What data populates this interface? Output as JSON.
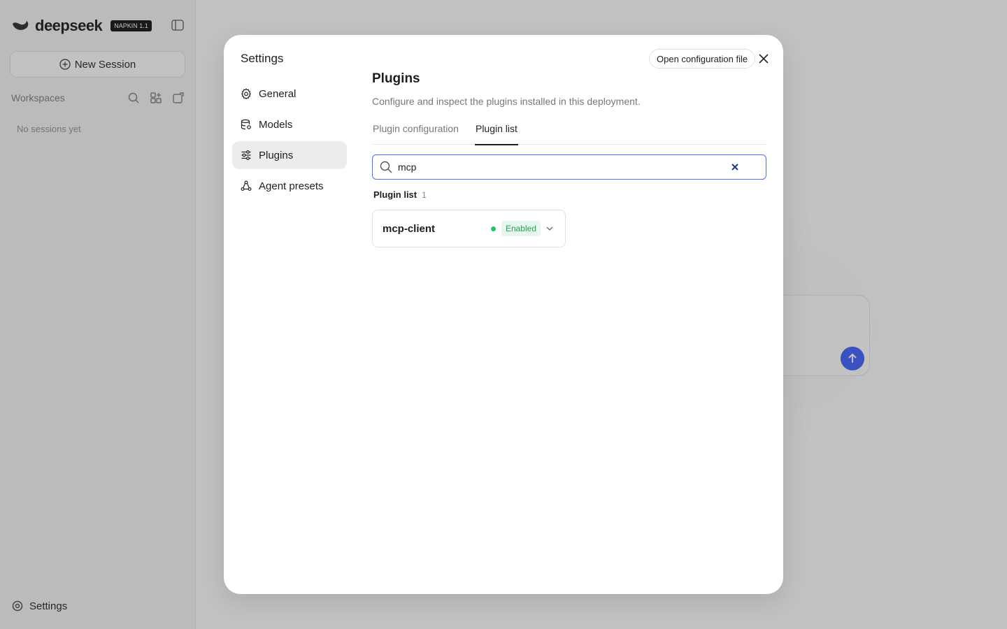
{
  "app": {
    "brand_name": "deepseek",
    "brand_badge": "NAPKIN 1.1",
    "new_session": "New Session",
    "workspaces": "Workspaces",
    "empty_sessions": "No sessions yet",
    "settings": "Settings",
    "accent": "#4d6bfe"
  },
  "modal": {
    "title": "Settings",
    "open_config": "Open configuration file",
    "nav": [
      {
        "label": "General",
        "icon": "gear-icon"
      },
      {
        "label": "Models",
        "icon": "database-icon"
      },
      {
        "label": "Plugins",
        "icon": "sliders-icon",
        "active": true
      },
      {
        "label": "Agent presets",
        "icon": "network-icon"
      }
    ]
  },
  "page": {
    "title": "Plugins",
    "description": "Configure and inspect the plugins installed in this deployment.",
    "tabs": [
      {
        "label": "Plugin configuration",
        "active": false
      },
      {
        "label": "Plugin list",
        "active": true
      }
    ],
    "search": {
      "value": "mcp"
    },
    "list_title": "Plugin list",
    "list_count": "1",
    "plugins": [
      {
        "name": "mcp-client",
        "status": "Enabled",
        "status_color": "#22c55e"
      }
    ]
  }
}
